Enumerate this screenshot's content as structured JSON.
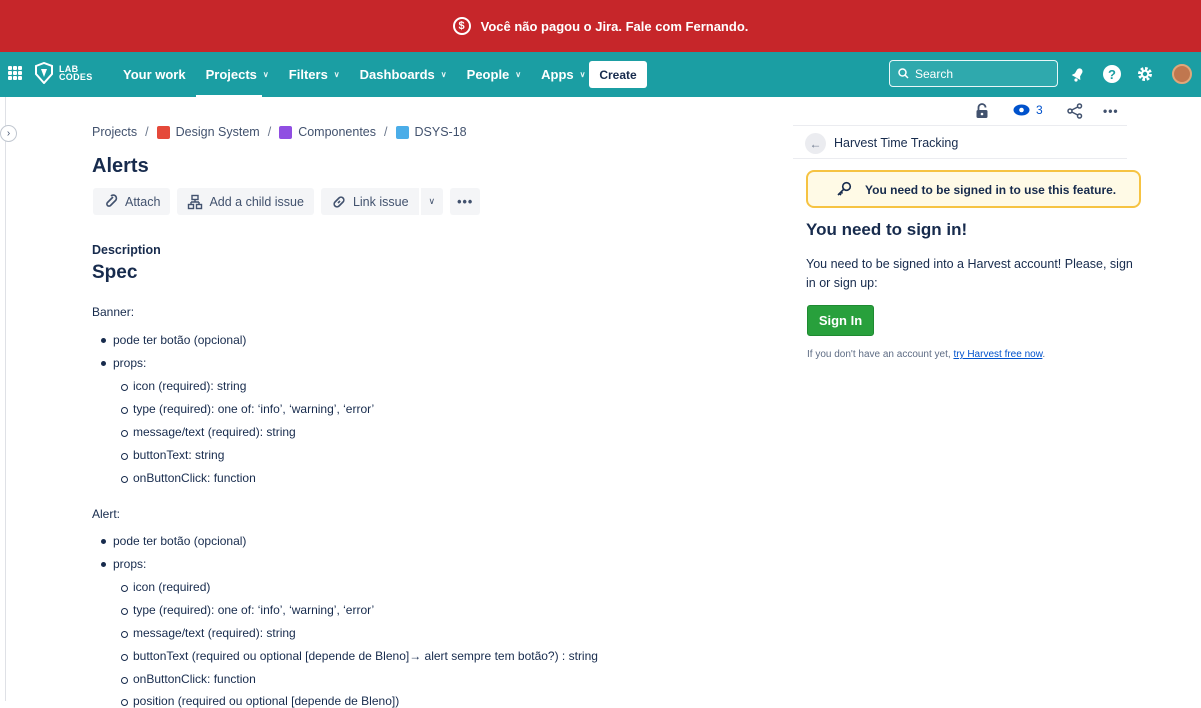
{
  "banner": {
    "text": "Você não pagou o Jira. Fale com Fernando."
  },
  "nav": {
    "logo_line1": "LAB",
    "logo_line2": "CODES",
    "items": [
      {
        "label": "Your work"
      },
      {
        "label": "Projects"
      },
      {
        "label": "Filters"
      },
      {
        "label": "Dashboards"
      },
      {
        "label": "People"
      },
      {
        "label": "Apps"
      }
    ],
    "create_label": "Create",
    "search_placeholder": "Search"
  },
  "breadcrumb": {
    "root": "Projects",
    "project": "Design System",
    "epic": "Componentes",
    "issue": "DSYS-18",
    "colors": {
      "project": "#e5493a",
      "epic": "#904ee2",
      "issue": "#4bade8"
    }
  },
  "issue": {
    "title": "Alerts",
    "toolbar": {
      "attach": "Attach",
      "child": "Add a child issue",
      "link": "Link issue"
    },
    "description_label": "Description",
    "spec_heading": "Spec",
    "banner_heading": "Banner:",
    "banner_items": [
      "pode ter botão (opcional)",
      "props:"
    ],
    "banner_props": [
      "icon (required): string",
      "type (required): one of: ‘info’, ‘warning’, ‘error’",
      "message/text (required): string",
      "buttonText: string",
      "onButtonClick: function"
    ],
    "alert_heading": "Alert:",
    "alert_items": [
      "pode ter botão (opcional)",
      "props:"
    ],
    "alert_props": [
      "icon (required)",
      "type (required): one of: ‘info’, ‘warning’, ‘error’",
      "message/text (required): string",
      "buttonText (required ou optional [depende de Bleno]→ alert sempre tem botão?) : string",
      "onButtonClick: function",
      "position (required ou optional [depende de Bleno])"
    ]
  },
  "panel": {
    "watchers": "3",
    "app_title": "Harvest Time Tracking",
    "warning": "You need to be signed in to use this feature.",
    "heading": "You need to sign in!",
    "paragraph": "You need to be signed into a Harvest account! Please, sign in or sign up:",
    "button": "Sign In",
    "footer_prefix": "If you don't have an account yet, ",
    "footer_link": "try Harvest free now",
    "footer_suffix": "."
  },
  "colors": {
    "banner_red": "#c6262a",
    "nav_teal": "#1b9ea3",
    "sign_in_green": "#28a03c",
    "warning_border": "#f6c342"
  }
}
